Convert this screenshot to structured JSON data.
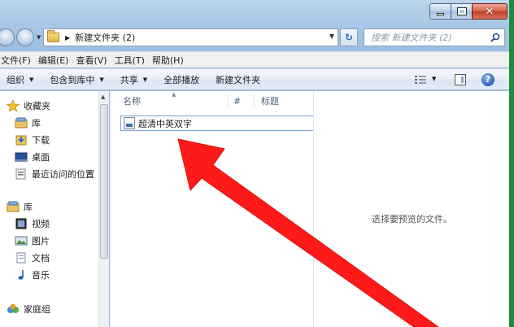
{
  "window": {
    "breadcrumb": "新建文件夹 (2)",
    "search_placeholder": "搜索 新建文件夹 (2)"
  },
  "menubar": {
    "items": [
      "文件(F)",
      "编辑(E)",
      "查看(V)",
      "工具(T)",
      "帮助(H)"
    ]
  },
  "toolbar": {
    "organize": "组织",
    "include_library": "包含到库中",
    "share": "共享",
    "play_all": "全部播放",
    "new_folder": "新建文件夹"
  },
  "sidebar": {
    "favorites": "收藏夹",
    "fav_items": [
      "库",
      "下载",
      "桌面",
      "最近访问的位置"
    ],
    "libraries": "库",
    "lib_items": [
      "视频",
      "图片",
      "文档",
      "音乐"
    ],
    "homegroup": "家庭组"
  },
  "columns": {
    "name": "名称",
    "number": "#",
    "title": "标题"
  },
  "files": [
    {
      "name": "超清中英双字"
    }
  ],
  "preview": {
    "empty_text": "选择要预览的文件。"
  },
  "colors": {
    "annotation_arrow": "#ff1a1a",
    "window_border_accent": "#1f8a3a"
  }
}
